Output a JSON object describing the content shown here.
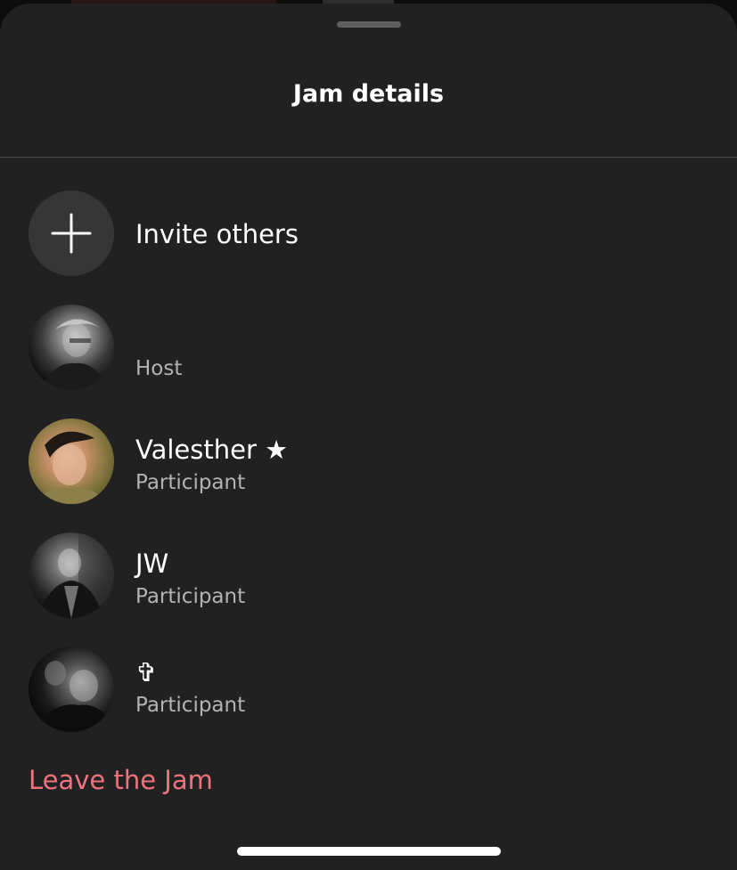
{
  "sheet": {
    "title": "Jam details"
  },
  "invite": {
    "label": "Invite others",
    "icon": "plus-icon"
  },
  "participants": [
    {
      "name": "",
      "role": "Host"
    },
    {
      "name": "Valesther ★",
      "role": "Participant"
    },
    {
      "name": "JW",
      "role": "Participant"
    },
    {
      "name": "✞",
      "role": "Participant"
    }
  ],
  "actions": {
    "leave_label": "Leave the Jam"
  },
  "colors": {
    "sheet_background": "#212121",
    "text_primary": "#ffffff",
    "text_secondary": "#b3b3b3",
    "destructive": "#f0727f"
  }
}
